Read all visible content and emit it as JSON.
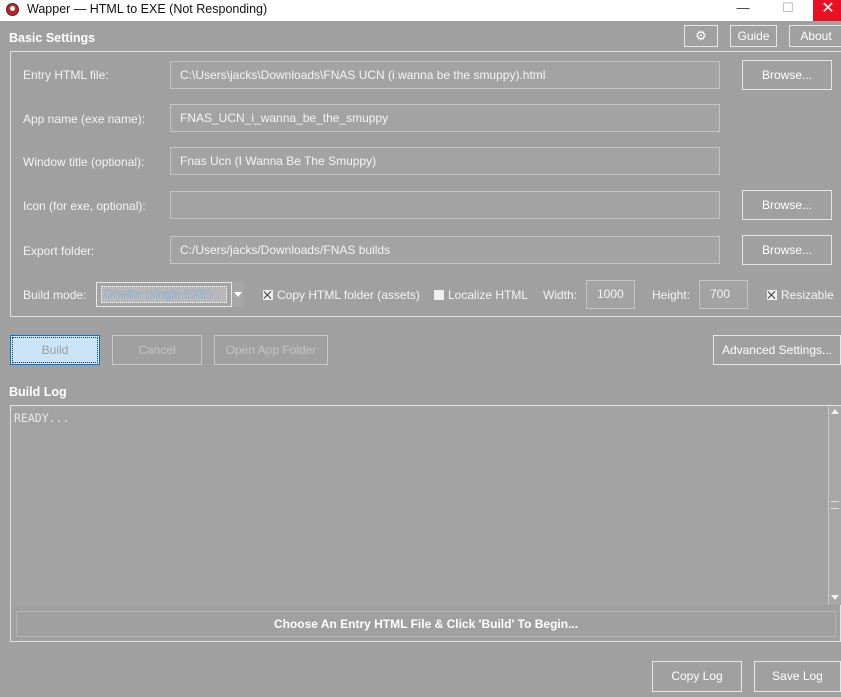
{
  "window": {
    "title": "Wapper — HTML to EXE (Not Responding)",
    "minimize_glyph": "—",
    "maximize_glyph": "☐",
    "close_glyph": "✕"
  },
  "toolbar": {
    "settings_icon": "⚙",
    "guide_label": "Guide",
    "about_label": "About"
  },
  "basic_settings": {
    "heading": "Basic Settings",
    "entry_label": "Entry HTML file:",
    "entry_value": "C:\\Users\\jacks\\Downloads\\FNAS UCN (i wanna be the smuppy).html",
    "app_name_label": "App name (exe name):",
    "app_name_value": "FNAS_UCN_i_wanna_be_the_smuppy",
    "window_title_label": "Window title (optional):",
    "window_title_value": "Fnas Ucn (I Wanna Be The Smuppy)",
    "icon_label": "Icon (for exe, optional):",
    "icon_value": "",
    "export_label": "Export folder:",
    "export_value": "C:/Users/jacks/Downloads/FNAS builds",
    "browse_label": "Browse...",
    "build_mode_label": "Build mode:",
    "build_mode_value": "Onefile (single EXE)",
    "copy_html_label": "Copy HTML folder (assets)",
    "copy_html_checked": true,
    "localize_label": "Localize HTML",
    "localize_checked": false,
    "width_label": "Width:",
    "width_value": "1000",
    "height_label": "Height:",
    "height_value": "700",
    "resizable_label": "Resizable",
    "resizable_checked": true
  },
  "actions": {
    "build_label": "Build",
    "cancel_label": "Cancel",
    "open_folder_label": "Open App Folder",
    "advanced_label": "Advanced Settings..."
  },
  "build_log": {
    "heading": "Build Log",
    "text": "READY...",
    "status": "Choose An Entry HTML File & Click 'Build' To Begin...",
    "copy_label": "Copy Log",
    "save_label": "Save Log"
  },
  "colors": {
    "window_bg": "#a0a0a0",
    "close_red": "#e81123",
    "build_highlight": "#cce4f7"
  }
}
